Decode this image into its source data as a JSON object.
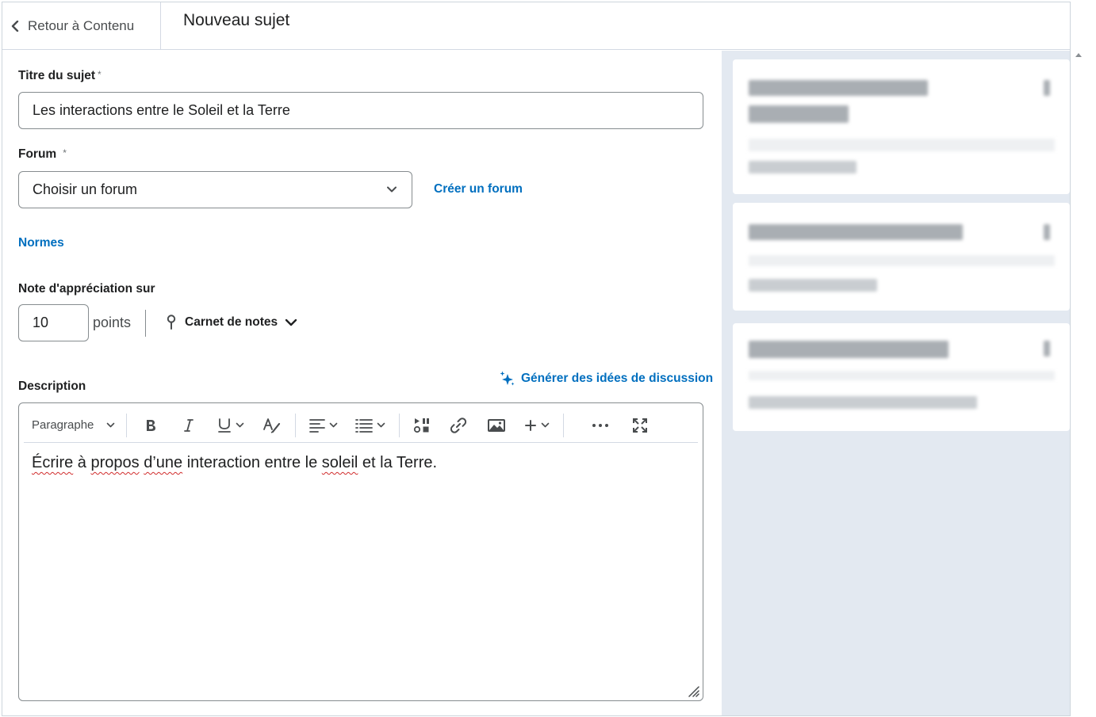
{
  "header": {
    "back_label": "Retour à Contenu",
    "title": "Nouveau sujet"
  },
  "form": {
    "topic_title": {
      "label": "Titre du sujet",
      "required_mark": "*",
      "value": "Les interactions entre le Soleil et la Terre"
    },
    "forum": {
      "label": "Forum",
      "required_mark": "*",
      "selected": "Choisir un forum",
      "create_link": "Créer un forum"
    },
    "rubrics_link": "Normes",
    "grade": {
      "label": "Note d'appréciation sur",
      "value": "10",
      "unit": "points",
      "gradebook_label": "Carnet de notes"
    },
    "description": {
      "label": "Description",
      "generate_link": "Générer des idées de discussion",
      "paragraph_format": "Paragraphe",
      "content_parts": [
        "Écrire",
        " à ",
        "propos",
        " ",
        "d’une",
        " interaction entre le ",
        "soleil",
        " et la Terre."
      ]
    }
  },
  "colors": {
    "link": "#006fbf",
    "border": "#868c8f",
    "side_panel_bg": "#e3e9f1",
    "spellcheck": "#d12c2c"
  },
  "icons": {
    "back": "chevron-left-icon",
    "select": "chevron-down-icon",
    "gradebook": "pin-icon",
    "generate": "sparkle-icon",
    "toolbar": [
      "bold-icon",
      "italic-icon",
      "underline-icon",
      "text-style-icon",
      "align-icon",
      "list-icon",
      "insert-stuff-icon",
      "link-icon",
      "image-icon",
      "plus-icon",
      "more-icon",
      "fullscreen-icon"
    ]
  }
}
